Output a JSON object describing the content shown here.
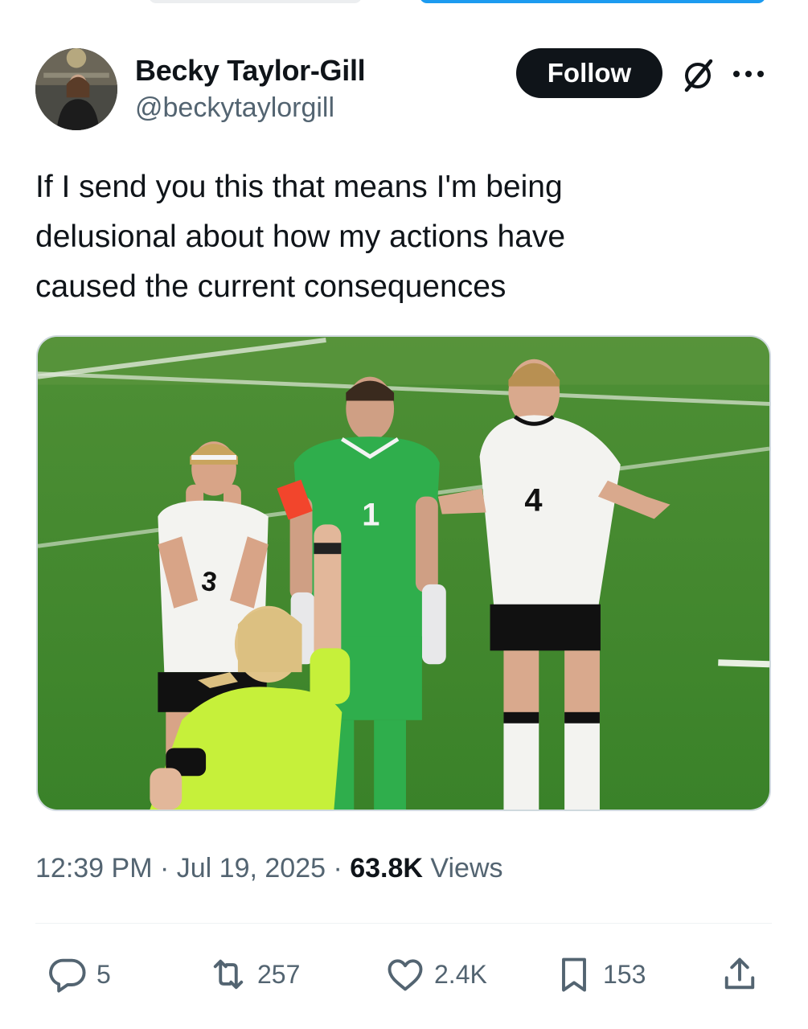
{
  "author": {
    "display_name": "Becky Taylor-Gill",
    "handle": "@beckytaylorgill"
  },
  "header": {
    "follow_label": "Follow",
    "icons": [
      "grok-icon",
      "more-icon"
    ]
  },
  "tweet": {
    "text": "If I send you this that means I'm being\ndelusional about how my actions have\ncaused the current consequences",
    "time": "12:39 PM",
    "separator1": " · ",
    "date": "Jul 19, 2025",
    "separator2": " · ",
    "views_count": "63.8K",
    "views_label": " Views"
  },
  "media": {
    "jersey_numbers": [
      "3",
      "1",
      "4"
    ]
  },
  "actions": {
    "replies": "5",
    "retweets": "257",
    "likes": "2.4K",
    "bookmarks": "153",
    "icons": [
      "reply-icon",
      "retweet-icon",
      "like-icon",
      "bookmark-icon",
      "share-icon"
    ]
  },
  "colors": {
    "follow_bg": "#0f1419",
    "secondary_text": "#536471",
    "pitch_green": "#3f8a2c",
    "referee_yellow": "#c6f03a",
    "goalkeeper_green": "#2fae4c",
    "red_card": "#f2452c"
  }
}
